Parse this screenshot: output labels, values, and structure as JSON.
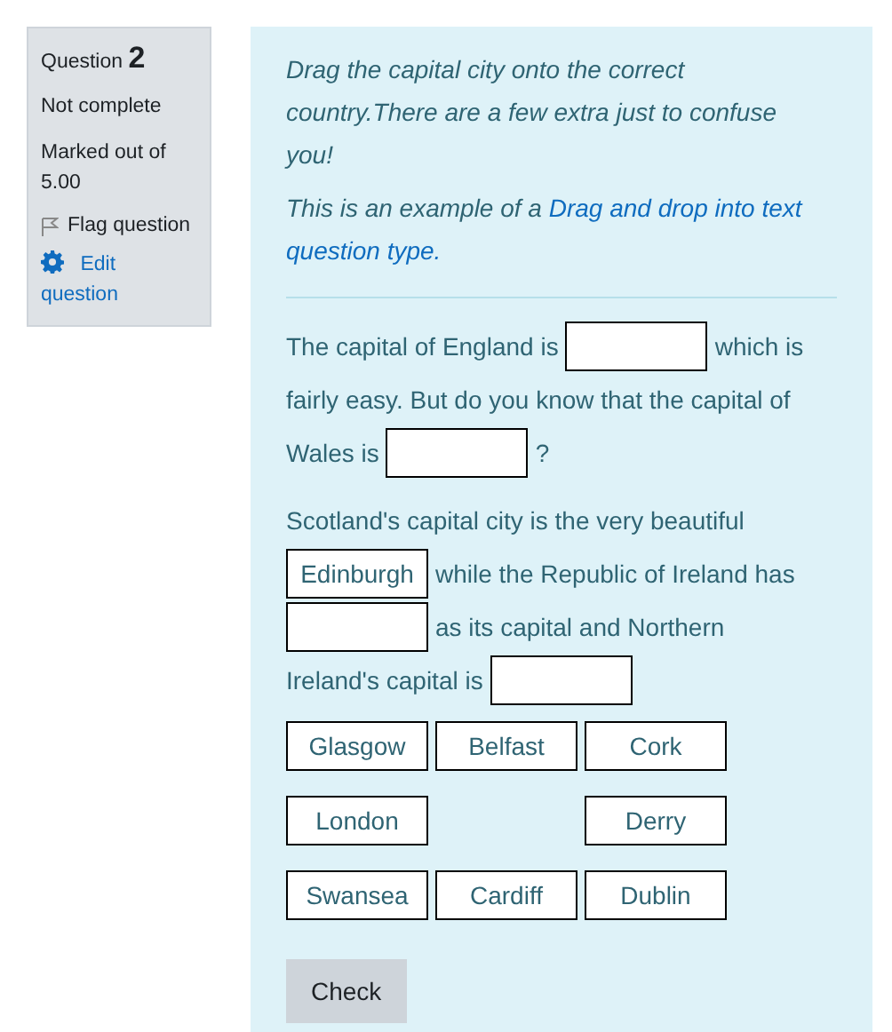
{
  "info": {
    "label": "Question",
    "number": "2",
    "state": "Not complete",
    "marks": "Marked out of 5.00",
    "flag": "Flag question",
    "edit": "Edit question"
  },
  "intro": [
    [
      [
        {
          "kind": "text",
          "text": "Drag the capital city onto the correct"
        }
      ],
      [
        {
          "kind": "text",
          "text": "country.There are a few extra just to confuse"
        }
      ],
      [
        {
          "kind": "text",
          "text": "you!"
        }
      ]
    ],
    [
      [
        {
          "kind": "text",
          "text": "This is an example of a "
        },
        {
          "kind": "link",
          "text": "Drag and drop into text"
        }
      ],
      [
        {
          "kind": "link",
          "text": "question type."
        }
      ]
    ]
  ],
  "paragraphs": [
    [
      [
        {
          "kind": "text",
          "text": "The capital of England is"
        },
        {
          "kind": "blank"
        },
        {
          "kind": "text",
          "text": "which is"
        }
      ],
      [
        {
          "kind": "text",
          "text": "fairly easy. But do you know that the capital of"
        }
      ],
      [
        {
          "kind": "text",
          "text": "Wales is"
        },
        {
          "kind": "blank"
        },
        {
          "kind": "text",
          "text": "?"
        }
      ]
    ],
    [
      [
        {
          "kind": "text",
          "text": "Scotland's capital city is the very beautiful"
        }
      ],
      [
        {
          "kind": "blank",
          "value": "Edinburgh"
        },
        {
          "kind": "text",
          "text": "while the Republic of Ireland has"
        }
      ],
      [
        {
          "kind": "blank"
        },
        {
          "kind": "text",
          "text": "as its capital and Northern"
        }
      ],
      [
        {
          "kind": "text",
          "text": "Ireland's capital is"
        },
        {
          "kind": "blank"
        }
      ]
    ]
  ],
  "choices": [
    [
      {
        "kind": "choice",
        "label": "Glasgow"
      },
      {
        "kind": "choice",
        "label": "Belfast"
      },
      {
        "kind": "choice",
        "label": "Cork"
      }
    ],
    [
      {
        "kind": "choice",
        "label": "London"
      },
      {
        "kind": "empty"
      },
      {
        "kind": "choice",
        "label": "Derry"
      }
    ],
    [
      {
        "kind": "choice",
        "label": "Swansea"
      },
      {
        "kind": "choice",
        "label": "Cardiff"
      },
      {
        "kind": "choice",
        "label": "Dublin"
      }
    ]
  ],
  "button": "Check"
}
